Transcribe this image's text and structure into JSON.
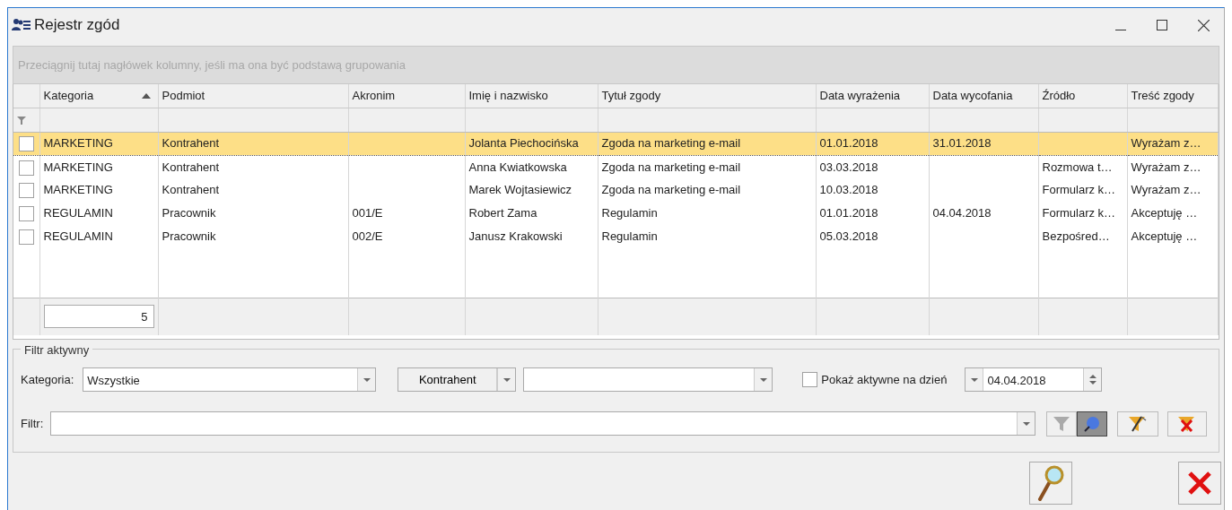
{
  "window": {
    "title": "Rejestr zgód"
  },
  "group_by_hint": "Przeciągnij tutaj nagłówek kolumny, jeśli ma ona być podstawą grupowania",
  "table": {
    "columns": [
      {
        "label": "Kategoria",
        "sorted": true
      },
      {
        "label": "Podmiot",
        "sorted": false
      },
      {
        "label": "Akronim",
        "sorted": false
      },
      {
        "label": "Imię i nazwisko",
        "sorted": false
      },
      {
        "label": "Tytuł zgody",
        "sorted": false
      },
      {
        "label": "Data wyrażenia",
        "sorted": false
      },
      {
        "label": "Data wycofania",
        "sorted": false
      },
      {
        "label": "Źródło",
        "sorted": false
      },
      {
        "label": "Treść zgody",
        "sorted": false
      }
    ],
    "rows": [
      {
        "checked": false,
        "selected": true,
        "cells": [
          "MARKETING",
          "Kontrahent",
          "",
          "Jolanta Piechocińska",
          "Zgoda na marketing e-mail",
          "01.01.2018",
          "31.01.2018",
          "",
          "Wyrażam z…"
        ]
      },
      {
        "checked": false,
        "selected": false,
        "cells": [
          "MARKETING",
          "Kontrahent",
          "",
          "Anna Kwiatkowska",
          "Zgoda na marketing e-mail",
          "03.03.2018",
          "",
          "Rozmowa t…",
          "Wyrażam z…"
        ]
      },
      {
        "checked": false,
        "selected": false,
        "cells": [
          "MARKETING",
          "Kontrahent",
          "",
          "Marek Wojtasiewicz",
          "Zgoda na marketing e-mail",
          "10.03.2018",
          "",
          "Formularz k…",
          "Wyrażam z…"
        ]
      },
      {
        "checked": false,
        "selected": false,
        "cells": [
          "REGULAMIN",
          "Pracownik",
          "001/E",
          "Robert Zama",
          "Regulamin",
          "01.01.2018",
          "04.04.2018",
          "Formularz k…",
          "Akceptuję …"
        ]
      },
      {
        "checked": false,
        "selected": false,
        "cells": [
          "REGULAMIN",
          "Pracownik",
          "002/E",
          "Janusz Krakowski",
          "Regulamin",
          "05.03.2018",
          "",
          "Bezpośred…",
          "Akceptuję …"
        ]
      }
    ],
    "footer_count": "5"
  },
  "filter": {
    "legend": "Filtr aktywny",
    "category_label": "Kategoria:",
    "category_value": "Wszystkie",
    "subject_button": "Kontrahent",
    "active_on_day": {
      "label": "Pokaż aktywne na dzień",
      "checked": false
    },
    "date": "04.04.2018",
    "filter_label": "Filtr:",
    "toggles": [
      {
        "kind": "funnel",
        "selected": false
      },
      {
        "kind": "pin",
        "selected": true
      }
    ]
  }
}
